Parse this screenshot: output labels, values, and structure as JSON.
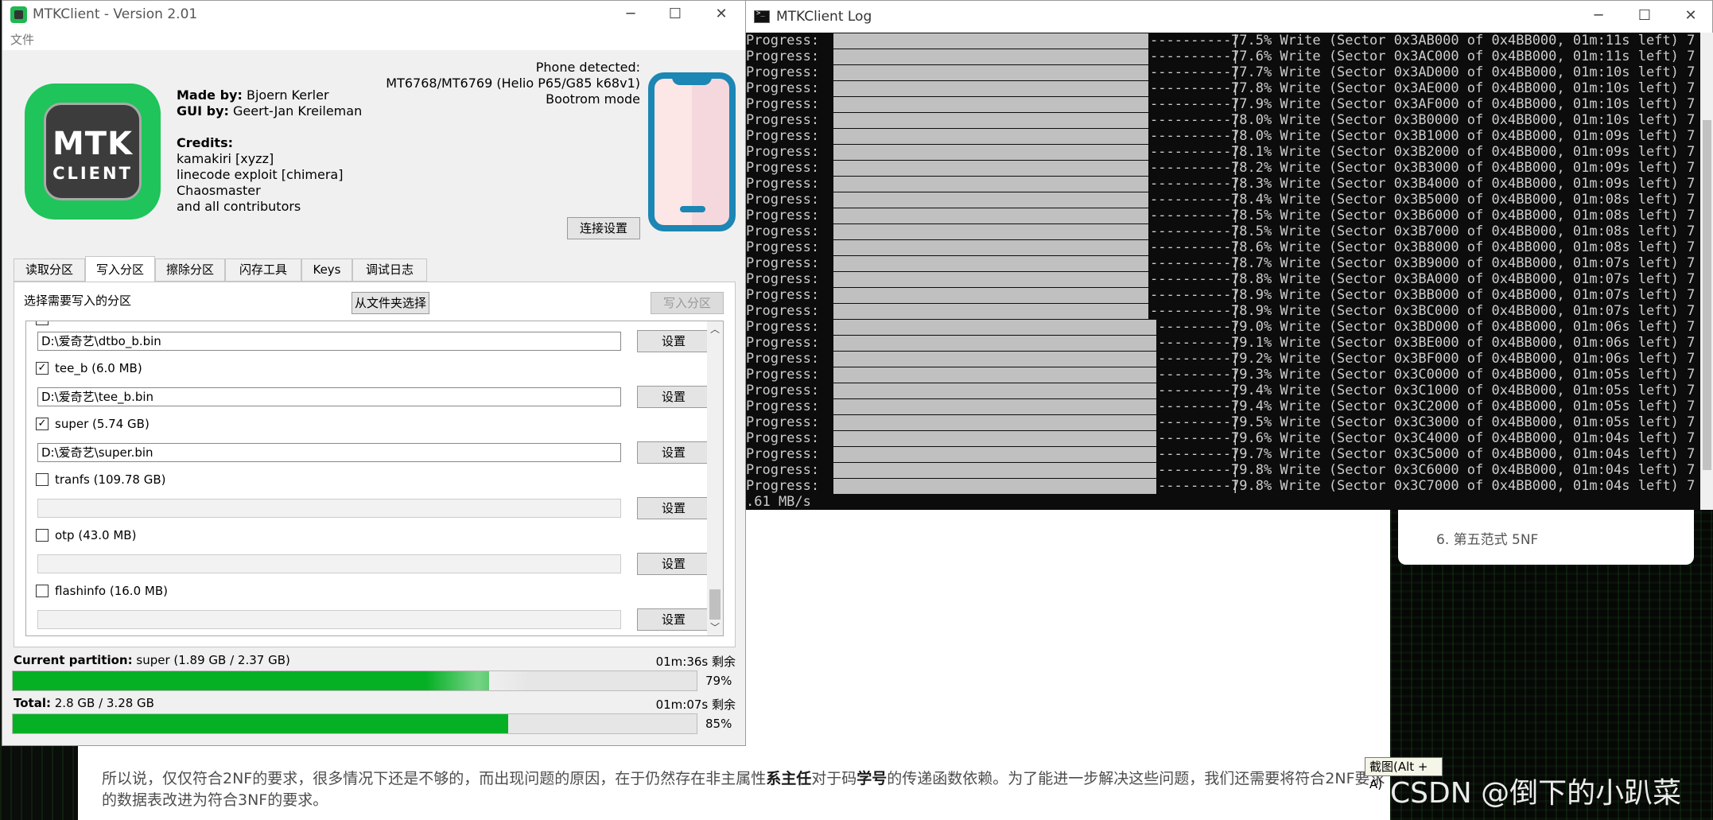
{
  "main_window": {
    "title": "MTKClient - Version 2.01",
    "menu": "文件",
    "logo_line1": "MTK",
    "logo_line2": "CLIENT",
    "made_by_label": "Made by:",
    "made_by": "Bjoern Kerler",
    "gui_by_label": "GUI by:",
    "gui_by": "Geert-Jan Kreileman",
    "credits_label": "Credits:",
    "credits": [
      "kamakiri [xyzz]",
      "linecode exploit [chimera]",
      "Chaosmaster",
      "and all contributors"
    ],
    "phone_detected": "Phone detected:",
    "phone_model": "MT6768/MT6769 (Helio P65/G85 k68v1)",
    "phone_mode": "Bootrom mode",
    "connect_settings": "连接设置",
    "tabs": [
      "读取分区",
      "写入分区",
      "擦除分区",
      "闪存工具",
      "Keys",
      "调试日志"
    ],
    "active_tab": 1,
    "select_label": "选择需要写入的分区",
    "from_folder": "从文件夹选择",
    "write_button": "写入分区",
    "set_label": "设置",
    "partitions": [
      {
        "checked": true,
        "label": "",
        "path": "D:\\爱奇艺\\dtbo_b.bin"
      },
      {
        "checked": true,
        "label": "tee_b (6.0 MB)",
        "path": "D:\\爱奇艺\\tee_b.bin"
      },
      {
        "checked": true,
        "label": "super (5.74 GB)",
        "path": "D:\\爱奇艺\\super.bin"
      },
      {
        "checked": false,
        "label": "tranfs (109.78 GB)",
        "path": ""
      },
      {
        "checked": false,
        "label": "otp (43.0 MB)",
        "path": ""
      },
      {
        "checked": false,
        "label": "flashinfo (16.0 MB)",
        "path": ""
      }
    ],
    "current_label": "Current partition:",
    "current_value": "super (1.89 GB / 2.37 GB)",
    "current_remaining": "01m:36s 剩余",
    "current_percent": "79%",
    "current_fraction": 0.79,
    "total_label": "Total:",
    "total_value": "2.8 GB / 3.28 GB",
    "total_remaining": "01m:07s 剩余",
    "total_percent": "85%",
    "total_fraction": 0.85,
    "accent": "#06b025"
  },
  "log_window": {
    "title": "MTKClient Log",
    "prefix": "Progress:",
    "lines": [
      "77.5% Write (Sector 0x3AB000 of 0x4BB000, 01m:11s left) 7",
      "77.6% Write (Sector 0x3AC000 of 0x4BB000, 01m:11s left) 7",
      "77.7% Write (Sector 0x3AD000 of 0x4BB000, 01m:10s left) 7",
      "77.8% Write (Sector 0x3AE000 of 0x4BB000, 01m:10s left) 7",
      "77.9% Write (Sector 0x3AF000 of 0x4BB000, 01m:10s left) 7",
      "78.0% Write (Sector 0x3B0000 of 0x4BB000, 01m:10s left) 7",
      "78.0% Write (Sector 0x3B1000 of 0x4BB000, 01m:09s left) 7",
      "78.1% Write (Sector 0x3B2000 of 0x4BB000, 01m:09s left) 7",
      "78.2% Write (Sector 0x3B3000 of 0x4BB000, 01m:09s left) 7",
      "78.3% Write (Sector 0x3B4000 of 0x4BB000, 01m:09s left) 7",
      "78.4% Write (Sector 0x3B5000 of 0x4BB000, 01m:08s left) 7",
      "78.5% Write (Sector 0x3B6000 of 0x4BB000, 01m:08s left) 7",
      "78.5% Write (Sector 0x3B7000 of 0x4BB000, 01m:08s left) 7",
      "78.6% Write (Sector 0x3B8000 of 0x4BB000, 01m:08s left) 7",
      "78.7% Write (Sector 0x3B9000 of 0x4BB000, 01m:07s left) 7",
      "78.8% Write (Sector 0x3BA000 of 0x4BB000, 01m:07s left) 7",
      "78.9% Write (Sector 0x3BB000 of 0x4BB000, 01m:07s left) 7",
      "78.9% Write (Sector 0x3BC000 of 0x4BB000, 01m:07s left) 7",
      "79.0% Write (Sector 0x3BD000 of 0x4BB000, 01m:06s left) 7",
      "79.1% Write (Sector 0x3BE000 of 0x4BB000, 01m:06s left) 7",
      "79.2% Write (Sector 0x3BF000 of 0x4BB000, 01m:06s left) 7",
      "79.3% Write (Sector 0x3C0000 of 0x4BB000, 01m:05s left) 7",
      "79.4% Write (Sector 0x3C1000 of 0x4BB000, 01m:05s left) 7",
      "79.4% Write (Sector 0x3C2000 of 0x4BB000, 01m:05s left) 7",
      "79.5% Write (Sector 0x3C3000 of 0x4BB000, 01m:05s left) 7",
      "79.6% Write (Sector 0x3C4000 of 0x4BB000, 01m:04s left) 7",
      "79.7% Write (Sector 0x3C5000 of 0x4BB000, 01m:04s left) 7",
      "79.8% Write (Sector 0x3C6000 of 0x4BB000, 01m:04s left) 7",
      "79.8% Write (Sector 0x3C7000 of 0x4BB000, 01m:04s left) 7"
    ],
    "tail": ".61 MB/s"
  },
  "background": {
    "toc_item": "6. 第五范式 5NF",
    "paragraph_pre": "所以说，仅仅符合2NF的要求，很多情况下还是不够的，而出现问题的原因，在于仍然存在非主属性",
    "bold1": "系主任",
    "paragraph_mid": "对于码",
    "bold2": "学号",
    "paragraph_post": "的传递函数依赖。为了能进一步解决这些问题，我们还需要将符合2NF要求的数据表改进为符合3NF的要求。",
    "tooltip": "截图(Alt + A)",
    "watermark": "CSDN @倒下的小趴菜"
  }
}
